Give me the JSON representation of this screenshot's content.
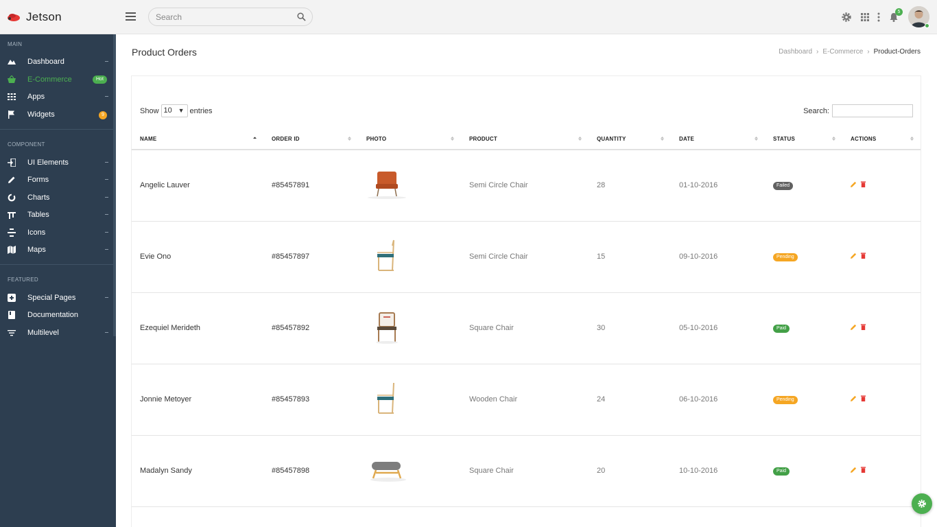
{
  "brand": {
    "name": "Jetson"
  },
  "header": {
    "search_placeholder": "Search",
    "notification_count": "5"
  },
  "sidebar": {
    "sections": [
      {
        "title": "MAIN"
      },
      {
        "title": "COMPONENT"
      },
      {
        "title": "FEATURED"
      }
    ],
    "items": [
      {
        "label": "Dashboard",
        "icon": "dashboard-icon"
      },
      {
        "label": "E-Commerce",
        "icon": "basket-icon",
        "badge": "Hot",
        "active": true
      },
      {
        "label": "Apps",
        "icon": "apps-icon"
      },
      {
        "label": "Widgets",
        "icon": "flag-icon",
        "badge": "9"
      },
      {
        "label": "UI Elements",
        "icon": "login-icon"
      },
      {
        "label": "Forms",
        "icon": "pencil-icon"
      },
      {
        "label": "Charts",
        "icon": "donut-chart-icon"
      },
      {
        "label": "Tables",
        "icon": "table-icon"
      },
      {
        "label": "Icons",
        "icon": "icons-icon"
      },
      {
        "label": "Maps",
        "icon": "map-icon"
      },
      {
        "label": "Special Pages",
        "icon": "pages-icon"
      },
      {
        "label": "Documentation",
        "icon": "book-icon"
      },
      {
        "label": "Multilevel",
        "icon": "sort-icon"
      }
    ]
  },
  "page": {
    "title": "Product Orders",
    "breadcrumb": [
      "Dashboard",
      "E-Commerce",
      "Product-Orders"
    ]
  },
  "table_controls": {
    "show_label": "Show",
    "entries_value": "10",
    "entries_label": "entries",
    "search_label": "Search:"
  },
  "columns": [
    "NAME",
    "ORDER ID",
    "PHOTO",
    "PRODUCT",
    "QUANTITY",
    "DATE",
    "STATUS",
    "ACTIONS"
  ],
  "rows": [
    {
      "name": "Angelic Lauver",
      "order_id": "#85457891",
      "photo": "orange-armchair",
      "product": "Semi Circle Chair",
      "quantity": "28",
      "date": "01-10-2016",
      "status": "Failed",
      "status_color": "#616161"
    },
    {
      "name": "Evie Ono",
      "order_id": "#85457897",
      "photo": "wooden-teal-chair",
      "product": "Semi Circle Chair",
      "quantity": "15",
      "date": "09-10-2016",
      "status": "Pending",
      "status_color": "#f5a623"
    },
    {
      "name": "Ezequiel Merideth",
      "order_id": "#85457892",
      "photo": "wooden-armchair",
      "product": "Square Chair",
      "quantity": "30",
      "date": "05-10-2016",
      "status": "Paid",
      "status_color": "#43a047"
    },
    {
      "name": "Jonnie Metoyer",
      "order_id": "#85457893",
      "photo": "wooden-teal-chair",
      "product": "Wooden Chair",
      "quantity": "24",
      "date": "06-10-2016",
      "status": "Pending",
      "status_color": "#f5a623"
    },
    {
      "name": "Madalyn Sandy",
      "order_id": "#85457898",
      "photo": "grey-stool",
      "product": "Square Chair",
      "quantity": "20",
      "date": "10-10-2016",
      "status": "Paid",
      "status_color": "#43a047"
    }
  ],
  "colors": {
    "sidebar_bg": "#2d3e50",
    "accent_green": "#4caf50",
    "warning": "#f5a623",
    "danger": "#e53935"
  }
}
